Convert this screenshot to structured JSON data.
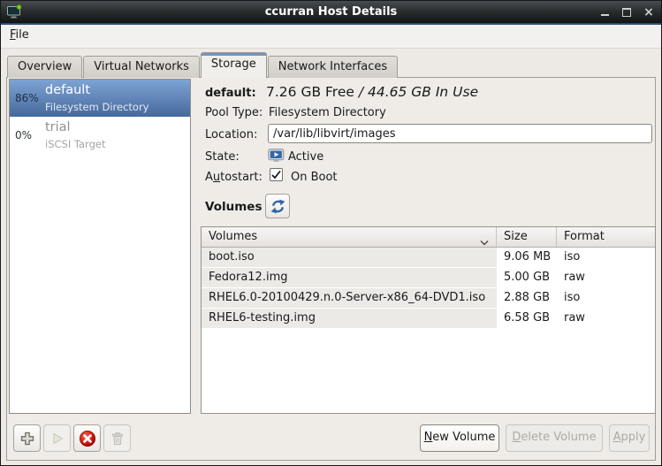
{
  "window": {
    "title": "ccurran Host Details"
  },
  "menubar": {
    "file_label": "File"
  },
  "tabs": [
    {
      "label": "Overview",
      "active": false
    },
    {
      "label": "Virtual Networks",
      "active": false
    },
    {
      "label": "Storage",
      "active": true
    },
    {
      "label": "Network Interfaces",
      "active": false
    }
  ],
  "pools": [
    {
      "percent": "86%",
      "name": "default",
      "type": "Filesystem Directory",
      "selected": true
    },
    {
      "percent": "0%",
      "name": "trial",
      "type": "iSCSI Target",
      "selected": false
    }
  ],
  "pool_details": {
    "name_label": "default:",
    "free": "7.26 GB Free",
    "in_use": "/ 44.65 GB In Use",
    "pool_type_label": "Pool Type:",
    "pool_type": "Filesystem Directory",
    "location_label": "Location:",
    "location": "/var/lib/libvirt/images",
    "state_label": "State:",
    "state": "Active",
    "autostart_label": "Autostart:",
    "autostart_value": "On Boot",
    "volumes_heading": "Volumes"
  },
  "volumes_table": {
    "columns": [
      "Volumes",
      "Size",
      "Format"
    ],
    "sorted_column": "Volumes",
    "sort_direction": "descending",
    "rows": [
      {
        "name": "boot.iso",
        "size": "9.06 MB",
        "format": "iso"
      },
      {
        "name": "Fedora12.img",
        "size": "5.00 GB",
        "format": "raw"
      },
      {
        "name": "RHEL6.0-20100429.n.0-Server-x86_64-DVD1.iso",
        "size": "2.88 GB",
        "format": "iso"
      },
      {
        "name": "RHEL6-testing.img",
        "size": "6.58 GB",
        "format": "raw"
      }
    ]
  },
  "actions": {
    "new_volume": "New Volume",
    "delete_volume": "Delete Volume",
    "apply": "Apply"
  },
  "icons": {
    "app": "monitor-with-green-dot",
    "minimize": "underscore",
    "maximize": "square-outline",
    "close": "x",
    "state_active": "running-vm-monitor-play",
    "refresh": "blue-circular-arrows",
    "add_pool": "plus",
    "start_pool": "play-triangle",
    "stop_pool": "red-circle-white-x",
    "delete_pool": "trash-can",
    "sort": "chevron-down",
    "checkbox": "checked"
  },
  "colors": {
    "accent_blue": "#3465a4",
    "selection_top": "#7da4d4",
    "selection_bottom": "#46699c",
    "titlebar_bg": "#2b2f31",
    "titlebar_accent": "#2b4a7a",
    "stop_red": "#cc0000",
    "sorted_column_bg": "#ebeae7",
    "pane_bg": "#efece8"
  }
}
